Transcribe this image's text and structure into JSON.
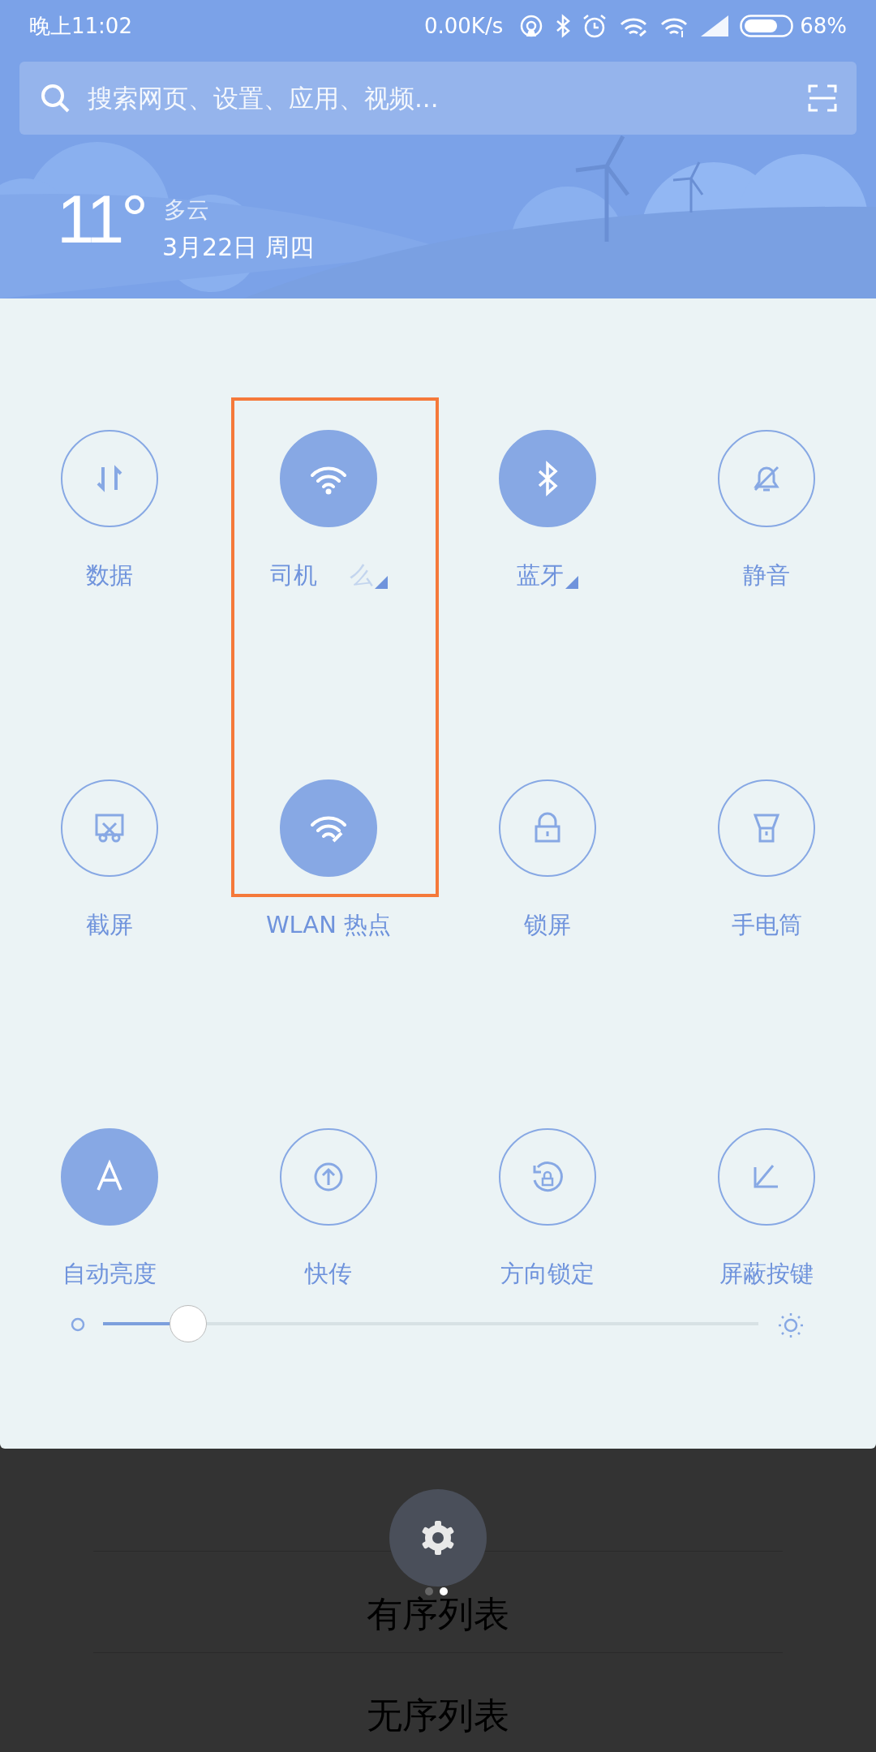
{
  "status_bar": {
    "time": "晚上11:02",
    "speed": "0.00K/s",
    "battery": "68%"
  },
  "search": {
    "placeholder": "搜索网页、设置、应用、视频..."
  },
  "weather": {
    "temperature": "11°",
    "condition": "多云",
    "date": "3月22日 周四"
  },
  "toggles": [
    {
      "label": "数据",
      "on": false,
      "expandable": false
    },
    {
      "label": "司机",
      "label_tail": "么",
      "on": true,
      "expandable": true
    },
    {
      "label": "蓝牙",
      "on": true,
      "expandable": true
    },
    {
      "label": "静音",
      "on": false,
      "expandable": false
    },
    {
      "label": "截屏",
      "on": false,
      "expandable": false
    },
    {
      "label": "WLAN 热点",
      "on": true,
      "expandable": false
    },
    {
      "label": "锁屏",
      "on": false,
      "expandable": false
    },
    {
      "label": "手电筒",
      "on": false,
      "expandable": false
    },
    {
      "label": "自动亮度",
      "on": true,
      "expandable": false
    },
    {
      "label": "快传",
      "on": false,
      "expandable": false
    },
    {
      "label": "方向锁定",
      "on": false,
      "expandable": false
    },
    {
      "label": "屏蔽按键",
      "on": false,
      "expandable": false
    }
  ],
  "brightness": {
    "level": 0.13
  },
  "menu": {
    "items": [
      "有序列表",
      "无序列表"
    ]
  },
  "pager": [
    {
      "selected": false
    },
    {
      "selected": true
    }
  ]
}
